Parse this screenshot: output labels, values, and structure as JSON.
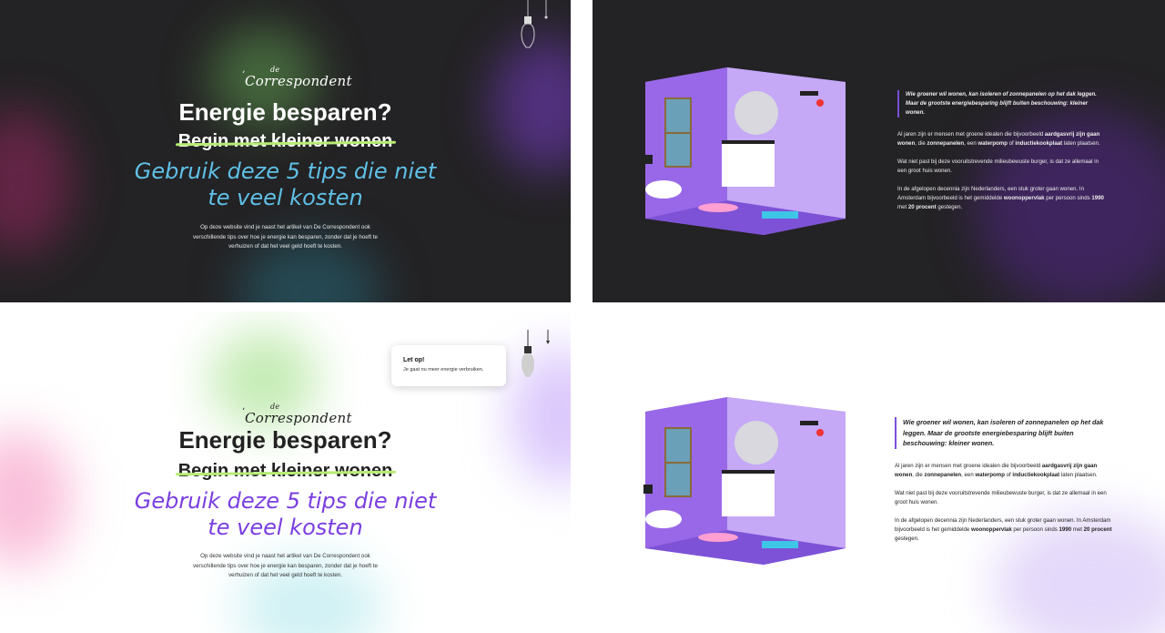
{
  "brand": {
    "logo_main": "Correspondent",
    "logo_de": "de",
    "logo_quote": "‘"
  },
  "hero": {
    "title": "Energie besparen?",
    "strikethrough": "Begin met kleiner wonen",
    "subtitle_line1": "Gebruik deze 5 tips die niet",
    "subtitle_line2": "te veel kosten",
    "intro_line1": "Op deze website vind je naast het artikel van De Correspondent ook",
    "intro_line2": "verschillende tips over hoe je energie kan besparen, zonder dat je hoeft te",
    "intro_line3": "verhuizen of dat het veel geld hoeft te kosten."
  },
  "article": {
    "quote": "Wie groener wil wonen, kan isoleren of zonnepanelen op het dak leggen. Maar de grootste energiebesparing blijft buiten beschouwing: kleiner wonen.",
    "p1_a": "Al jaren zijn er mensen met groene idealen die bijvoorbeeld ",
    "p1_b": "aardgasvrij zijn gaan wonen",
    "p1_c": ", die ",
    "p1_d": "zonnepanelen",
    "p1_e": ", een ",
    "p1_f": "waterpomp",
    "p1_g": " of ",
    "p1_h": "inductiekookplaat",
    "p1_i": " laten plaatsen.",
    "p2": "Wat niet past bij deze vooruitstrevende milieubewuste burger, is dat ze allemaal in een groot huis wonen.",
    "p3_a": "In de afgelopen decennia zijn Nederlanders, een stuk groter gaan wonen. In Amsterdam bijvoorbeeld is het gemiddelde ",
    "p3_b": "woonoppervlak",
    "p3_c": " per persoon sinds ",
    "p3_d": "1990",
    "p3_e": " met ",
    "p3_f": "20 procent",
    "p3_g": " gestegen."
  },
  "notice": {
    "title": "Let op!",
    "body": "Je gaat nu meer energie verbruiken."
  },
  "colors": {
    "dark_bg": "#232224",
    "light_bg": "#ffffff",
    "subtitle_dark": "#5fc0e6",
    "subtitle_light": "#7a3ee0",
    "strike_line": "#b7ec74",
    "room_purple": "#a87cf0",
    "accent_purple": "#7a4fd8"
  }
}
